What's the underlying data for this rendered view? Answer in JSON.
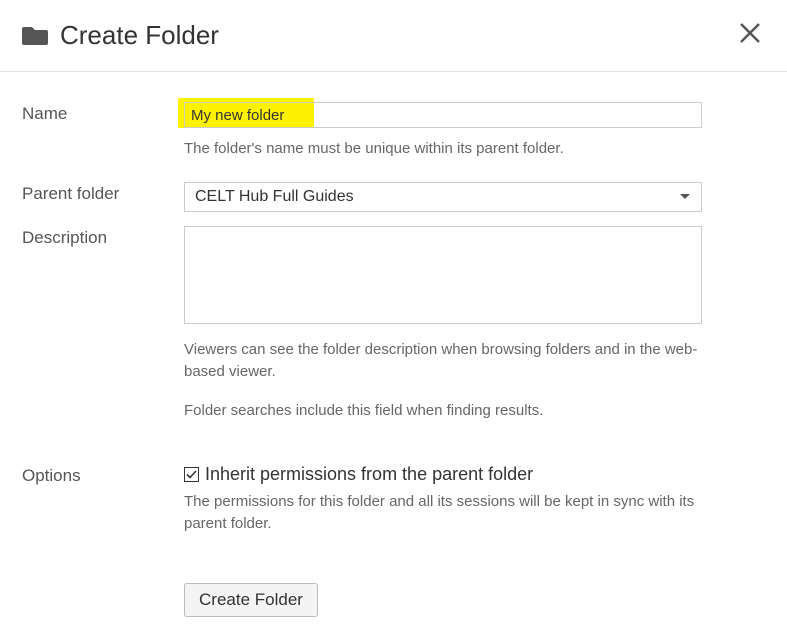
{
  "header": {
    "title": "Create Folder"
  },
  "form": {
    "name": {
      "label": "Name",
      "value": "My new folder",
      "helper": "The folder's name must be unique within its parent folder."
    },
    "parent": {
      "label": "Parent folder",
      "selected": "CELT Hub Full Guides"
    },
    "description": {
      "label": "Description",
      "value": "",
      "helper1": "Viewers can see the folder description when browsing folders and in the web-based viewer.",
      "helper2": "Folder searches include this field when finding results."
    },
    "options": {
      "label": "Options",
      "inherit": {
        "checked": true,
        "label": "Inherit permissions from the parent folder",
        "helper": "The permissions for this folder and all its sessions will be kept in sync with its parent folder."
      }
    },
    "submit": {
      "label": "Create Folder"
    }
  }
}
